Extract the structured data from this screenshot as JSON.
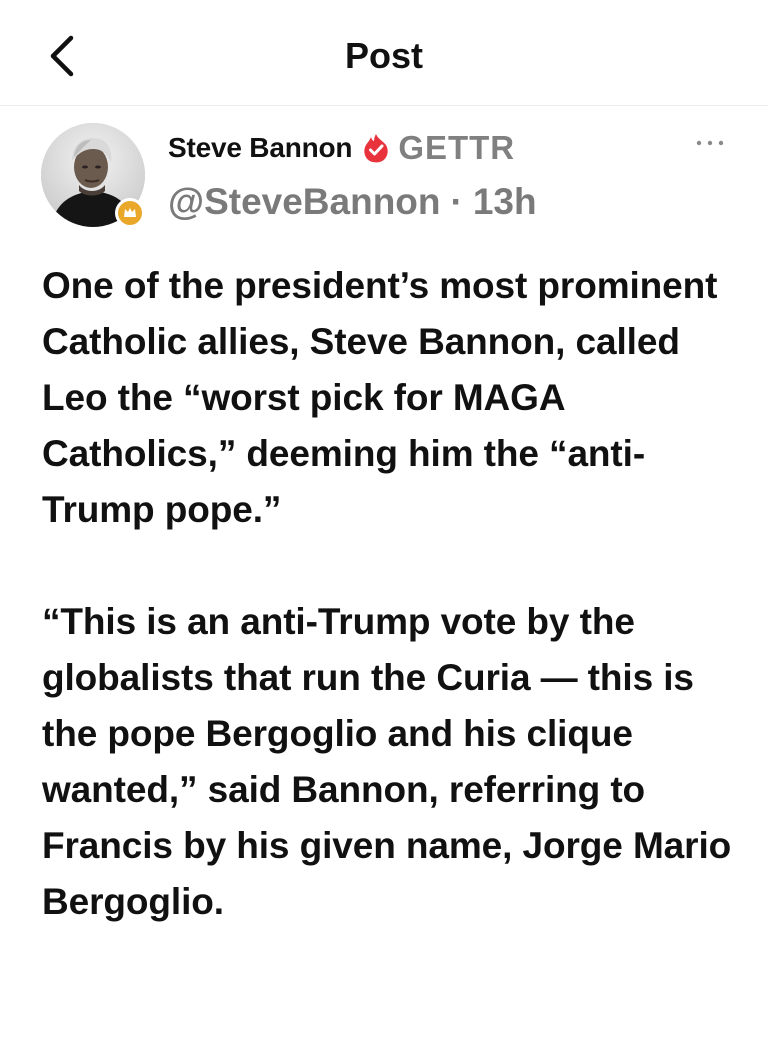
{
  "header": {
    "title": "Post"
  },
  "post": {
    "author": {
      "name": "Steve Bannon",
      "platform": "GETTR",
      "handle": "@SteveBannon",
      "separator": "·",
      "time": "13h"
    },
    "paragraphs": [
      "One of the president’s most prominent Catholic allies, Steve Bannon, called Leo the “worst pick for MAGA Catholics,” deeming him the “anti-Trump pope.”",
      "“This is an anti-Trump vote by the globalists that run the Curia — this is the pope Bergoglio and his clique wanted,” said Bannon, referring to Francis by his given name, Jorge Mario Bergoglio."
    ]
  },
  "icons": {
    "back": "chevron-left-icon",
    "verified": "red-flame-check-badge-icon",
    "avatar_badge": "gold-crown-badge-icon",
    "more": "more-horizontal-icon"
  },
  "colors": {
    "verified_red": "#e8323c",
    "badge_gold": "#e9a82a",
    "secondary_text": "#7a7a7a"
  }
}
